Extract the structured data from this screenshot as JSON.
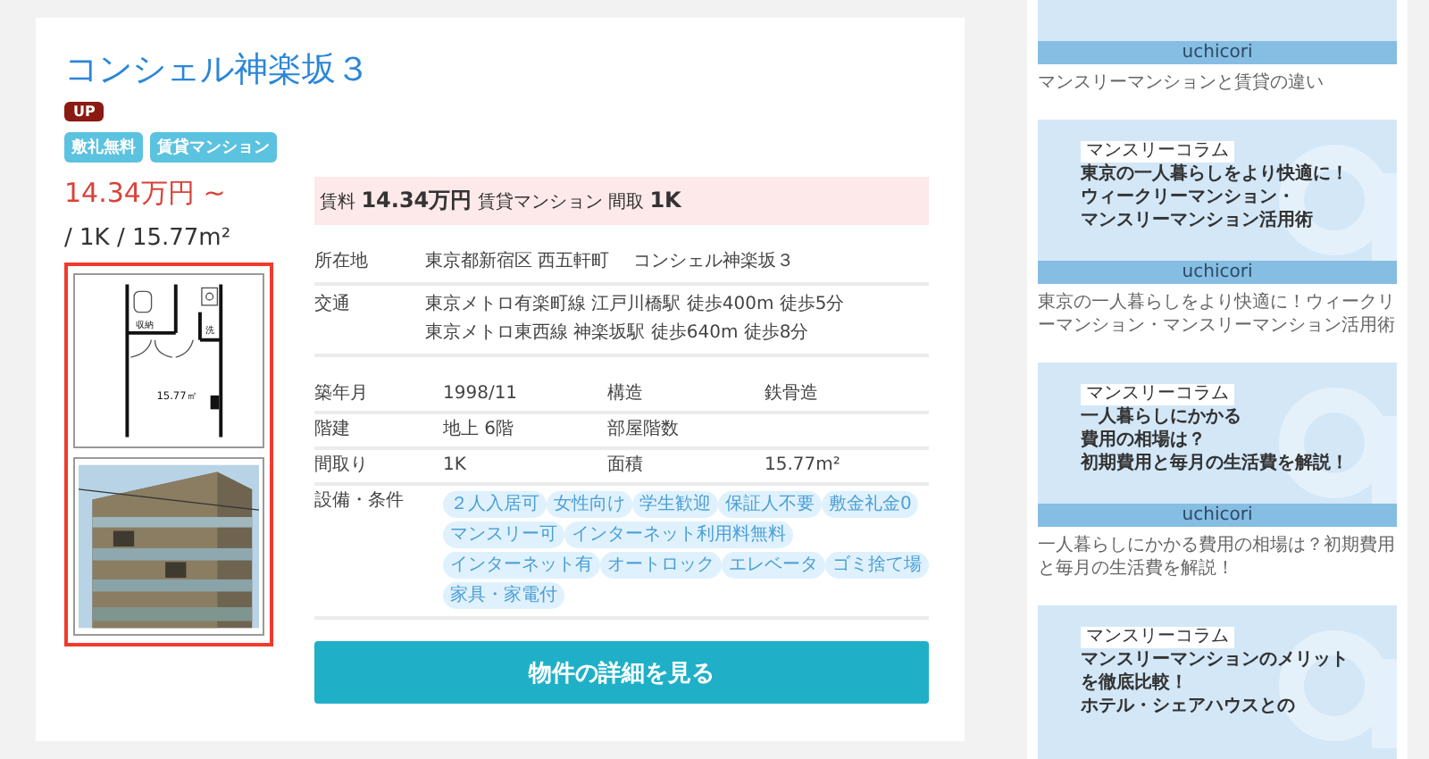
{
  "property": {
    "title": "コンシェル神楽坂３",
    "badge": "UP",
    "tags": [
      "敷礼無料",
      "賃貸マンション"
    ],
    "price": "14.34万円 ~",
    "summary": "/ 1K / 15.77m²",
    "floorplan": {
      "labels": [
        "収納",
        "洗",
        "15.77㎡"
      ]
    },
    "photo": {
      "kind": "picture"
    },
    "highlight": "賃料 **14.34万円** 賃貸マンション 間取 **1K**",
    "location": [
      {
        "label": "所在地",
        "lines": [
          "東京都新宿区 西五軒町　 コンシェル神楽坂３"
        ]
      },
      {
        "label": "交通",
        "lines": [
          "東京メトロ有楽町線 江戸川橋駅 徒歩400m 徒歩5分",
          "東京メトロ東西線 神楽坂駅 徒歩640m 徒歩8分"
        ]
      }
    ],
    "specs": [
      {
        "label": "築年月",
        "value": "1998/11",
        "label2": "構造",
        "value2": "鉄骨造"
      },
      {
        "label": "階建",
        "value": "地上 6階",
        "label2": "部屋階数"
      },
      {
        "label": "間取り",
        "value": "1K",
        "label2": "面積",
        "value2": "15.77m²"
      }
    ],
    "features": {
      "label": "設備・条件",
      "items": [
        "２人入居可",
        "女性向け",
        "学生歓迎",
        "保証人不要",
        "敷金礼金0",
        "マンスリー可",
        "インターネット利用料無料",
        "インターネット有",
        "オートロック",
        "エレベータ",
        "ゴミ捨て場",
        "家具・家電付"
      ]
    },
    "button": "物件の詳細を見る"
  },
  "sidebar": [
    {
      "kind": "cut_top",
      "logo": "uchicori",
      "caption": "マンスリーマンションと賃貸の違い"
    },
    {
      "kind": "full",
      "label": "マンスリーコラム",
      "heading": [
        "東京の一人暮らしをより快適に！",
        "ウィークリーマンション・",
        "マンスリーマンション活用術"
      ],
      "logo": "uchicori",
      "caption": "東京の一人暮らしをより快適に！ウィークリーマンション・マンスリーマンション活用術"
    },
    {
      "kind": "full",
      "label": "マンスリーコラム",
      "heading": [
        "一人暮らしにかかる",
        "費用の相場は？",
        "初期費用と毎月の生活費を解説！"
      ],
      "logo": "uchicori",
      "caption": "一人暮らしにかかる費用の相場は？初期費用と毎月の生活費を解説！"
    },
    {
      "kind": "cut_bottom",
      "label": "マンスリーコラム",
      "heading": [
        "マンスリーマンションのメリット",
        "を徹底比較！",
        "ホテル・シェアハウスとの"
      ]
    }
  ]
}
